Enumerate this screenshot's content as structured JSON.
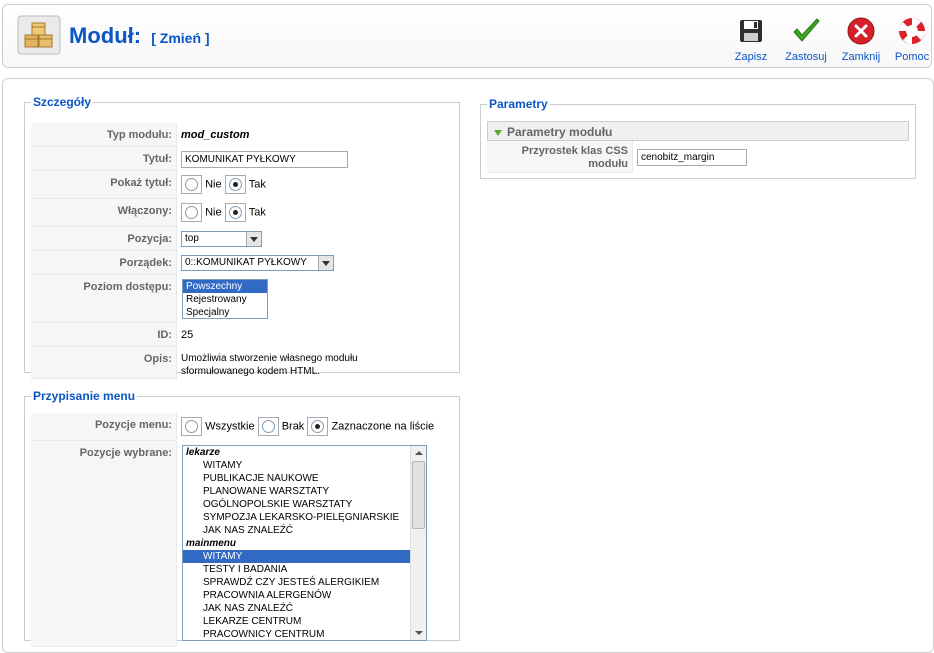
{
  "header": {
    "title": "Moduł:",
    "subtitle": "[ Zmień ]"
  },
  "toolbar": {
    "save": "Zapisz",
    "apply": "Zastosuj",
    "close": "Zamknij",
    "help": "Pomoc"
  },
  "details": {
    "legend": "Szczegóły",
    "type_label": "Typ modułu:",
    "type_value": "mod_custom",
    "title_label": "Tytuł:",
    "title_value": "KOMUNIKAT PYŁKOWY",
    "show_title_label": "Pokaż tytuł:",
    "no": "Nie",
    "yes": "Tak",
    "enabled_label": "Włączony:",
    "position_label": "Pozycja:",
    "position_value": "top",
    "order_label": "Porządek:",
    "order_value": "0::KOMUNIKAT PYŁKOWY",
    "access_label": "Poziom dostępu:",
    "access_options": [
      "Powszechny",
      "Rejestrowany",
      "Specjalny"
    ],
    "id_label": "ID:",
    "id_value": "25",
    "desc_label": "Opis:",
    "desc_line1": "Umożliwia stworzenie własnego modułu",
    "desc_line2": "sformułowanego kodem HTML."
  },
  "params": {
    "legend": "Parametry",
    "panel_title": "Parametry modułu",
    "css_label_1": "Przyrostek klas CSS",
    "css_label_2": "modułu",
    "css_value": "cenobitz_margin"
  },
  "menu": {
    "legend": "Przypisanie menu",
    "positions_label": "Pozycje menu:",
    "all": "Wszystkie",
    "none": "Brak",
    "selected": "Zaznaczone na liście",
    "chosen_label": "Pozycje wybrane:",
    "group1": "lekarze",
    "group1_items": [
      "WITAMY",
      "PUBLIKACJE NAUKOWE",
      "PLANOWANE WARSZTATY",
      "OGÓLNOPOLSKIE WARSZTATY",
      "SYMPOZJA LEKARSKO-PIELĘGNIARSKIE",
      "JAK NAS ZNALEŹĆ"
    ],
    "group2": "mainmenu",
    "group2_items": [
      "WITAMY",
      "TESTY I BADANIA",
      "SPRAWDŹ CZY JESTEŚ ALERGIKIEM",
      "PRACOWNIA ALERGENÓW",
      "JAK NAS ZNALEŹĆ",
      "LEKARZE CENTRUM",
      "PRACOWNICY CENTRUM"
    ]
  },
  "colors": {
    "accent": "#0b55c4",
    "selected_bg": "#316ac5"
  }
}
